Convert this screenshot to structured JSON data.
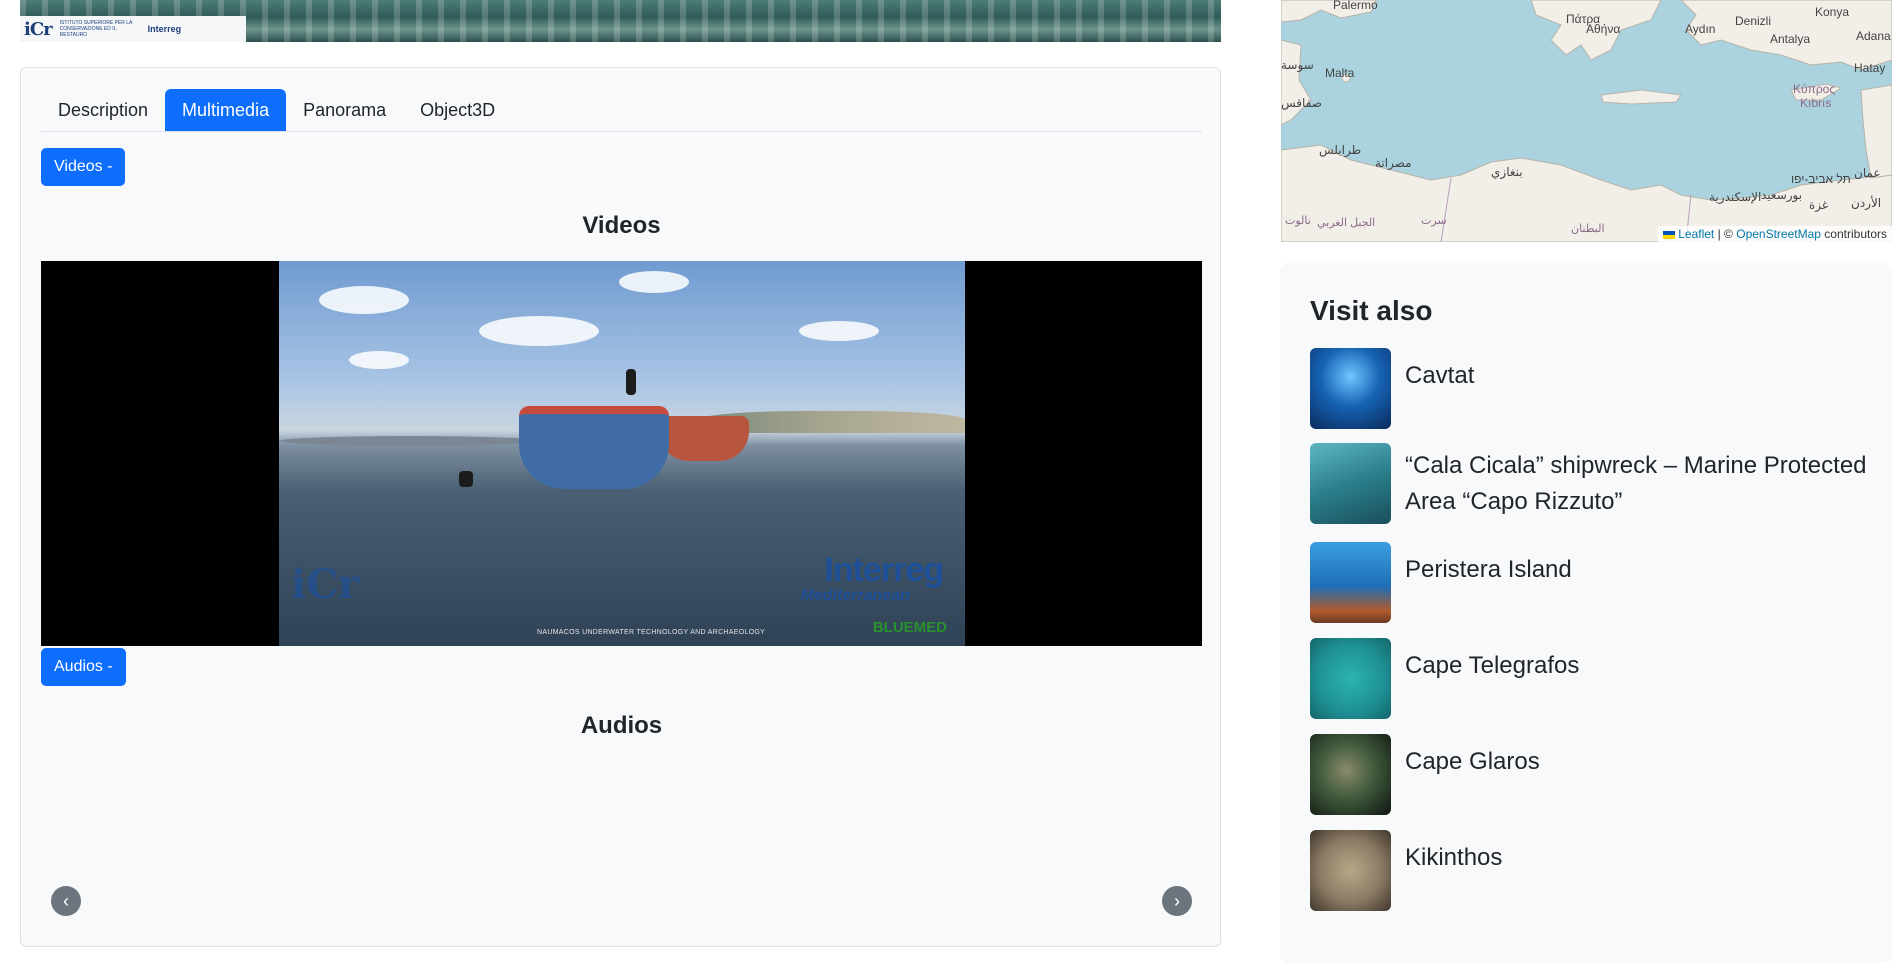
{
  "banner": {
    "logo_text": "iCr",
    "institute_text": "ISTITUTO SUPERIORE PER LA CONSERVAZIONE ED IL RESTAURO",
    "interreg_text": "Interreg"
  },
  "tabs": [
    {
      "label": "Description",
      "active": false
    },
    {
      "label": "Multimedia",
      "active": true
    },
    {
      "label": "Panorama",
      "active": false
    },
    {
      "label": "Object3D",
      "active": false
    }
  ],
  "multimedia": {
    "videos_toggle": "Videos -",
    "videos_heading": "Videos",
    "audios_toggle": "Audios -",
    "audios_heading": "Audios",
    "video_watermarks": {
      "interreg": "Interreg",
      "mediterranean": "Mediterranean",
      "bluemed": "BLUEMED",
      "naumacos": "NAUMACOS UNDERWATER TECHNOLOGY AND ARCHAEOLOGY",
      "icr": "iCr"
    },
    "prev_icon": "‹",
    "next_icon": "›"
  },
  "map": {
    "labels": {
      "palermo": "Palermo",
      "malta": "Malta",
      "athina": "Αθήνα",
      "patra": "Πάτρα",
      "aydin": "Aydın",
      "denizli": "Denizli",
      "konya": "Konya",
      "antalya": "Antalya",
      "adana": "Adana",
      "hatay": "Hatay",
      "kypros": "Κύπρος",
      "kibris": "Kıbrıs",
      "tripoli": "طرابلس",
      "misrata": "مصراتة",
      "benghazi": "بنغازي",
      "alexandria": "الإسكندرية",
      "telaviv": "תל אביב-יפו",
      "amman": "عمان",
      "gaza": "غزة",
      "port_said": "بورسعيد",
      "jordan": "الأردن",
      "sfax": "صفاقس",
      "sousse": "سوسة",
      "nalut": "نالوت",
      "jabal": "الجبل الغربي",
      "sirte": "سرت",
      "butnan": "البطنان"
    },
    "attribution": {
      "leaflet": "Leaflet",
      "separator": "| ©",
      "osm": "OpenStreetMap",
      "contributors": "contributors"
    }
  },
  "visit_also": {
    "title": "Visit also",
    "items": [
      {
        "label": "Cavtat",
        "thumb_color": "#1663b5"
      },
      {
        "label": "“Cala Cicala” shipwreck – Marine Protected Area “Capo Rizzuto”",
        "thumb_color": "#2b7f8c"
      },
      {
        "label": "Peristera Island",
        "thumb_color": "#1e6fb5"
      },
      {
        "label": "Cape Telegrafos",
        "thumb_color": "#1e8f94"
      },
      {
        "label": "Cape Glaros",
        "thumb_color": "#3f5a3c"
      },
      {
        "label": "Kikinthos",
        "thumb_color": "#8a7a64"
      }
    ]
  }
}
